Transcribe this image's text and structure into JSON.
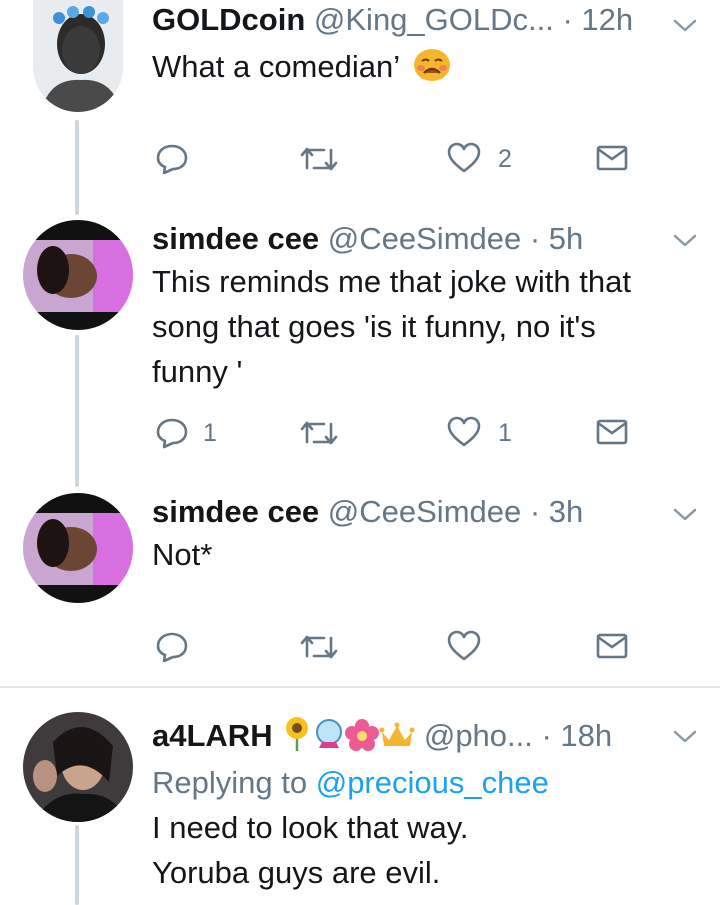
{
  "tweets": [
    {
      "name": "GOLDcoin",
      "handle": "@King_GOLDc...",
      "time": "· 12h",
      "text_lines": [
        "What a comedian’"
      ],
      "actions": {
        "reply_count": "",
        "retweet_count": "",
        "like_count": "2"
      }
    },
    {
      "name": "simdee cee",
      "handle": "@CeeSimdee",
      "time": "· 5h",
      "text_lines": [
        "This reminds me that joke with that",
        "song that goes 'is it funny, no it's",
        "funny '"
      ],
      "actions": {
        "reply_count": "1",
        "retweet_count": "",
        "like_count": "1"
      }
    },
    {
      "name": "simdee cee",
      "handle": "@CeeSimdee",
      "time": "· 3h",
      "text_lines": [
        "Not*"
      ],
      "actions": {
        "reply_count": "",
        "retweet_count": "",
        "like_count": ""
      }
    },
    {
      "name": "a4LARH",
      "handle": "@pho...",
      "time": "· 18h",
      "replying_prefix": "Replying to",
      "replying_to": "@precious_chee",
      "text_lines": [
        "I need to look that way.",
        "Yoruba guys are evil."
      ]
    }
  ],
  "colors": {
    "text": "#14171a",
    "secondary": "#657786",
    "link": "#1da1f2",
    "thread_line": "#ccd6dd"
  }
}
